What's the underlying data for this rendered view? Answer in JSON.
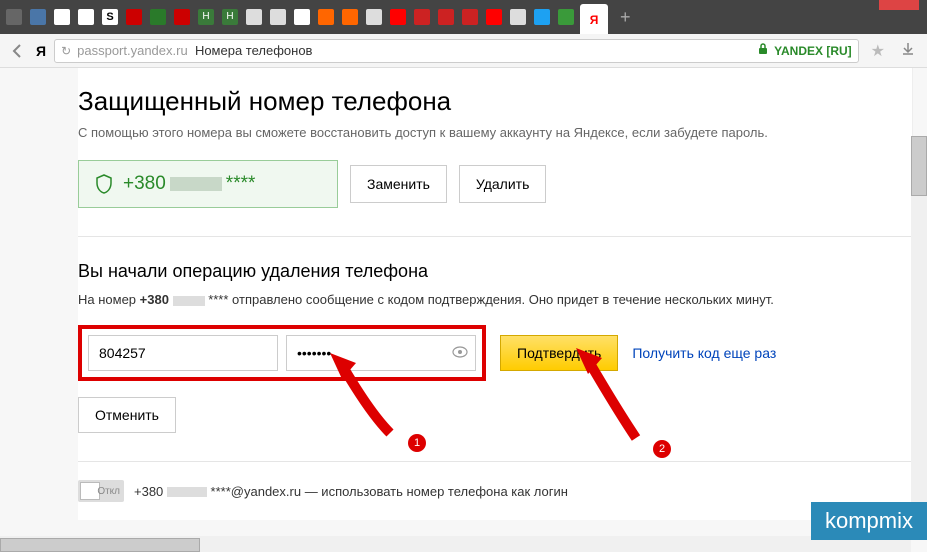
{
  "browser": {
    "active_tab_letter": "Я",
    "new_tab": "+",
    "url_gray": "passport.yandex.ru",
    "url_dark": "Номера телефонов",
    "security_label": "YANDEX [RU]",
    "ya_logo": "Я"
  },
  "page": {
    "h1": "Защищенный номер телефона",
    "subtitle": "С помощью этого номера вы сможете восстановить доступ к вашему аккаунту на Яндексе, если забудете пароль.",
    "phone_prefix": "+380",
    "phone_stars": "****",
    "replace_btn": "Заменить",
    "delete_btn": "Удалить",
    "h2": "Вы начали операцию удаления телефона",
    "info_prefix": "На номер ",
    "info_bold": "+380",
    "info_stars": " **** ",
    "info_rest": "отправлено сообщение с кодом подтверждения. Оно придет в течение нескольких минут.",
    "code_value": "804257",
    "pwd_value": "•••••••",
    "confirm_btn": "Подтвердить",
    "resend_link": "Получить код еще раз",
    "cancel_btn": "Отменить",
    "toggle_label": "Откл",
    "login_prefix": "+380",
    "login_stars": " ****",
    "login_domain": "@yandex.ru",
    "login_rest": " — использовать номер телефона как логин"
  },
  "annotation": {
    "badge1": "1",
    "badge2": "2"
  },
  "watermark": "kompmix"
}
